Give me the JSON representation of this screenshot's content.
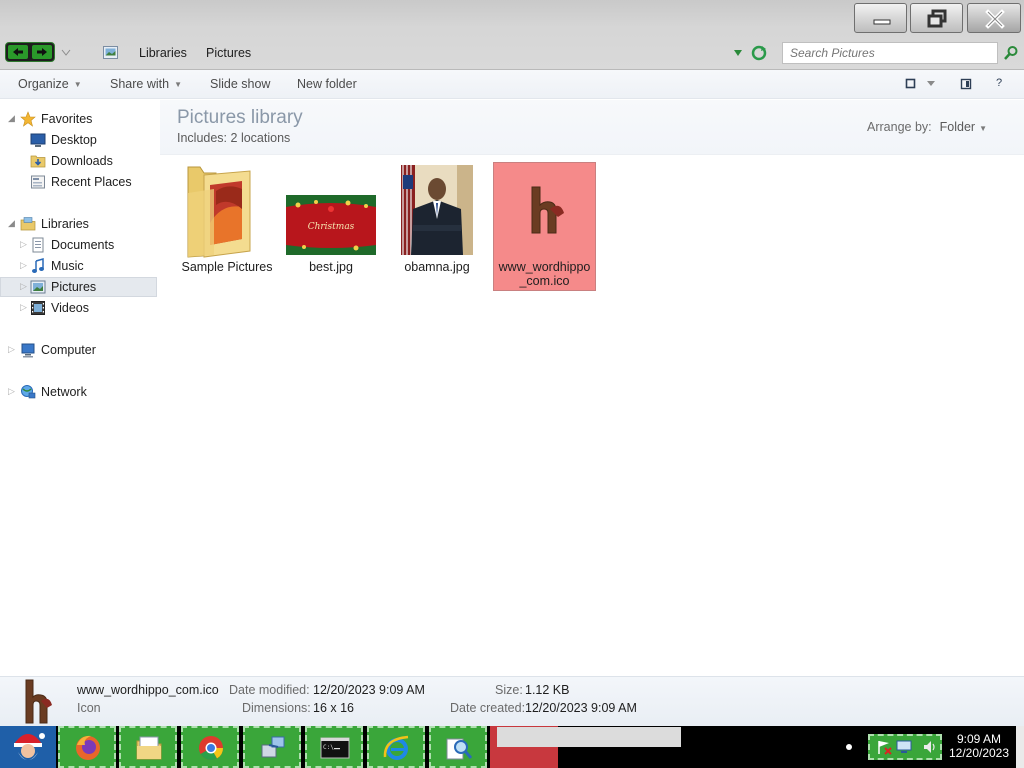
{
  "window": {
    "caption_buttons": {
      "minimize": "minimize-icon",
      "restore": "restore-icon",
      "close": "close-icon"
    }
  },
  "address": {
    "breadcrumb": [
      "Libraries",
      "Pictures"
    ],
    "search_placeholder": "Search Pictures"
  },
  "toolbar": {
    "organize": "Organize",
    "share_with": "Share with",
    "slide_show": "Slide show",
    "new_folder": "New folder",
    "help": "?"
  },
  "nav": {
    "favorites": "Favorites",
    "desktop": "Desktop",
    "downloads": "Downloads",
    "recent_places": "Recent Places",
    "libraries": "Libraries",
    "documents": "Documents",
    "music": "Music",
    "pictures": "Pictures",
    "videos": "Videos",
    "computer": "Computer",
    "network": "Network"
  },
  "library": {
    "title": "Pictures library",
    "includes_label": "Includes:",
    "includes_value": "2 locations",
    "arrange_label": "Arrange by:",
    "arrange_value": "Folder"
  },
  "files": [
    {
      "name": "Sample Pictures",
      "type": "folder"
    },
    {
      "name": "best.jpg",
      "type": "image"
    },
    {
      "name": "obamna.jpg",
      "type": "image"
    },
    {
      "name": "www_wordhippo_com.ico",
      "name_line1": "www_wordhippo",
      "name_line2": "_com.ico",
      "type": "icon",
      "selected": true
    }
  ],
  "details": {
    "filename": "www_wordhippo_com.ico",
    "filetype": "Icon",
    "date_modified_label": "Date modified:",
    "date_modified": "12/20/2023 9:09 AM",
    "dimensions_label": "Dimensions:",
    "dimensions": "16 x 16",
    "size_label": "Size:",
    "size": "1.12 KB",
    "date_created_label": "Date created:",
    "date_created": "12/20/2023 9:09 AM"
  },
  "taskbar": {
    "pinned": [
      "firefox-icon",
      "file-explorer-icon",
      "chrome-icon",
      "network-tool-icon",
      "command-prompt-icon",
      "internet-explorer-icon",
      "search-tool-icon"
    ],
    "time": "9:09 AM",
    "date": "12/20/2023"
  },
  "colors": {
    "selection": "#f58a8a",
    "taskbar_button": "#3aa63a",
    "library_title": "#8a98a8"
  }
}
